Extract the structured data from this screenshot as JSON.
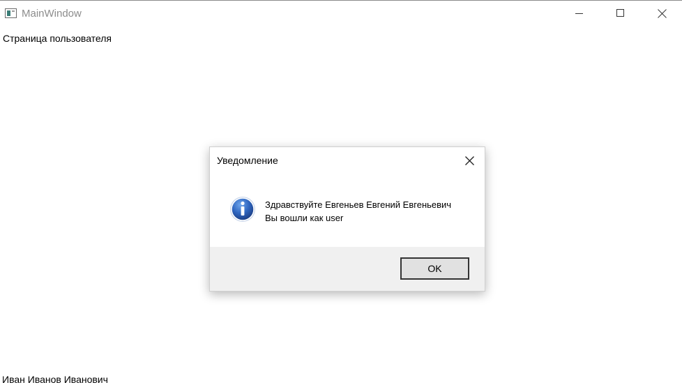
{
  "window": {
    "title": "MainWindow"
  },
  "main": {
    "page_label": "Страница пользователя",
    "user_name": "Иван Иванов Иванович"
  },
  "dialog": {
    "title": "Уведомление",
    "message_line1": "Здравствуйте Евгеньев Евгений Евгеньевич",
    "message_line2": "Вы вошли как user",
    "ok_label": "OK",
    "icon": "info-icon"
  },
  "colors": {
    "window_title_text": "#8c8c8c",
    "dialog_footer": "#f0f0f0",
    "info_icon_blue": "#2a5fb0"
  }
}
